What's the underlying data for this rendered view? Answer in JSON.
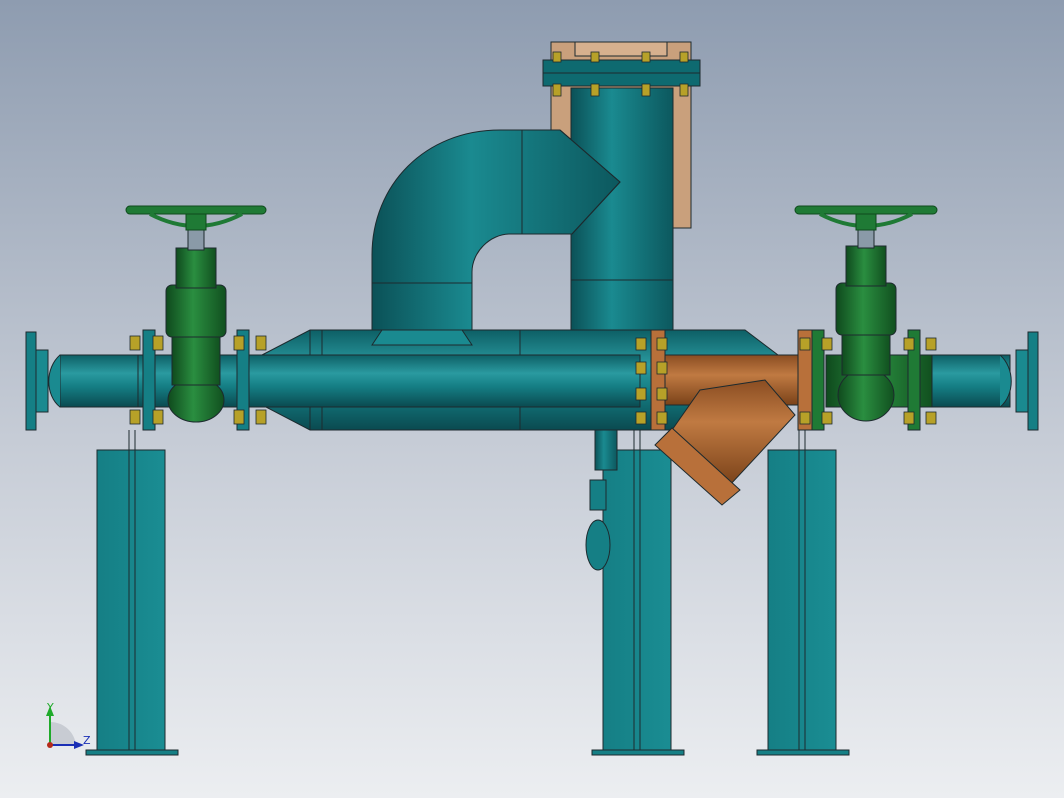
{
  "view": {
    "axis_triad": {
      "y_label": "Y",
      "z_label": "Z"
    }
  },
  "colors": {
    "pipe": "#157f85",
    "pipe_dark": "#0a4f55",
    "pipe_light": "#3fa7ad",
    "valve_green": "#1f7a35",
    "valve_dark": "#0f4a1d",
    "strainer_bronze": "#b8703a",
    "strainer_dark": "#6e3c18",
    "tan_plate": "#c9a07c",
    "bolt": "#b7a128",
    "outline": "#1d2a2e"
  },
  "components": [
    "inlet-flange",
    "gate-valve-left",
    "main-header-pipe",
    "bypass-elbow-loop",
    "vertical-vessel",
    "y-strainer",
    "gate-valve-right",
    "outlet-flange",
    "support-leg-left",
    "support-leg-middle",
    "support-leg-right"
  ]
}
